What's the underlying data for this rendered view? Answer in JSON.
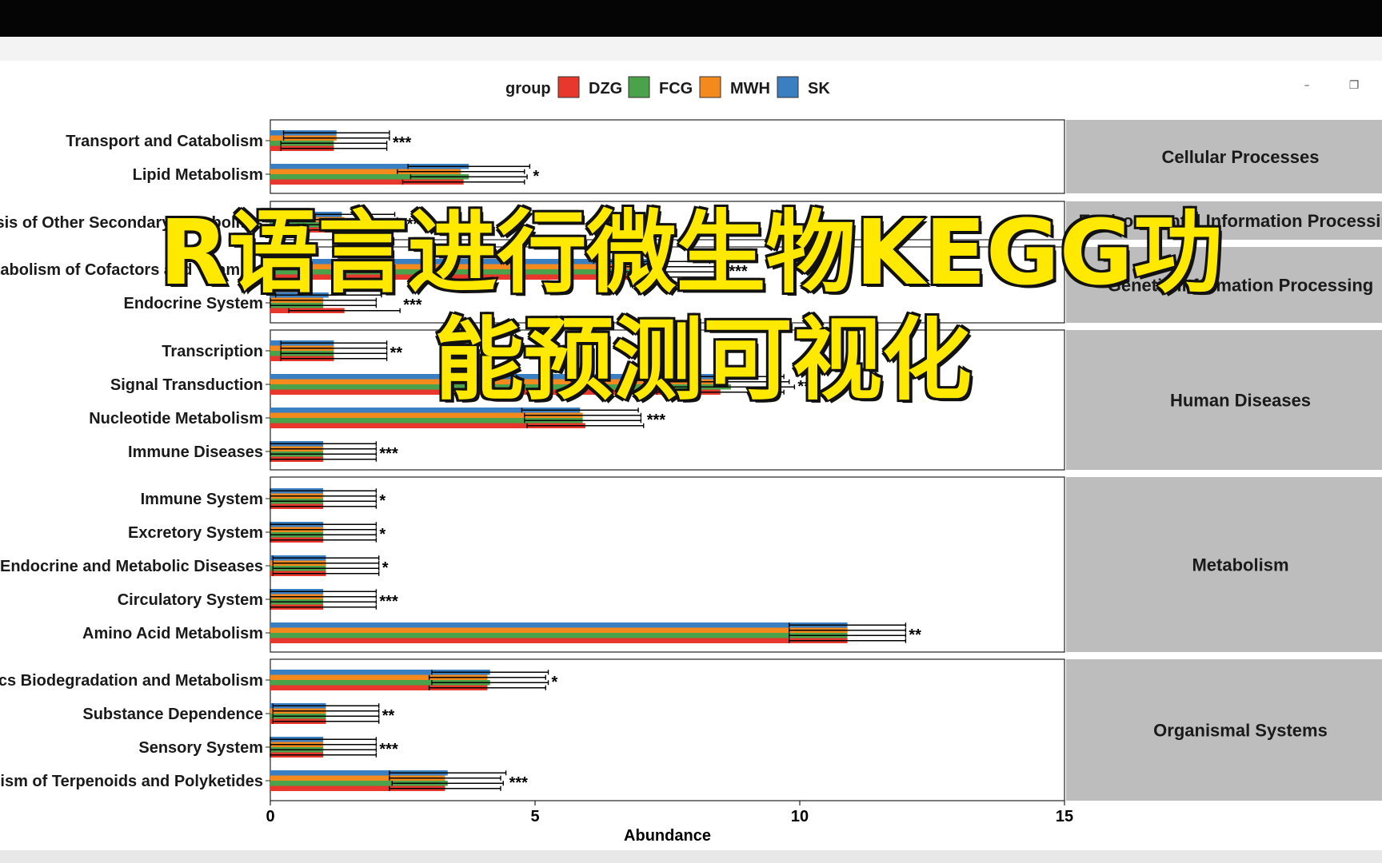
{
  "window": {
    "minimize_icon": "minimize-icon",
    "restore_icon": "restore-icon"
  },
  "overlay": {
    "line1": "R语言进行微生物KEGG功",
    "line2": "能预测可视化"
  },
  "chart_data": {
    "type": "bar",
    "orientation": "horizontal",
    "legend": {
      "title": "group",
      "position": "top",
      "entries": [
        {
          "name": "DZG",
          "color": "#e8372c"
        },
        {
          "name": "FCG",
          "color": "#4aa24a"
        },
        {
          "name": "MWH",
          "color": "#f48a1e"
        },
        {
          "name": "SK",
          "color": "#3a7fc1"
        }
      ]
    },
    "xlabel": "Abundance",
    "xlim": [
      0,
      15
    ],
    "xticks": [
      "0",
      "5",
      "10",
      "15"
    ],
    "grid": false,
    "panels": [
      {
        "label": "Cellular Processes",
        "rows": [
          {
            "label": "Transport and Catabolism",
            "values": [
              1.2,
              1.2,
              1.25,
              1.25
            ],
            "errors": [
              1.0,
              1.0,
              1.0,
              1.0
            ],
            "sig": "***"
          },
          {
            "label": "Lipid Metabolism",
            "values": [
              3.65,
              3.75,
              3.6,
              3.75
            ],
            "errors": [
              1.15,
              1.1,
              1.2,
              1.15
            ],
            "sig": "*"
          }
        ]
      },
      {
        "label": "Environmental Information Processing",
        "rows": [
          {
            "label": "Biosynthesis of Other Secondary Metabolites",
            "values": [
              1.4,
              1.3,
              1.4,
              1.35
            ],
            "errors": [
              1.0,
              1.0,
              1.0,
              1.0
            ],
            "sig": "***"
          }
        ]
      },
      {
        "label": "Genetic Information Processing",
        "rows": [
          {
            "label": "Metabolism of Cofactors and Vitamins",
            "values": [
              7.5,
              7.3,
              7.4,
              7.2
            ],
            "errors": [
              1.1,
              1.1,
              1.1,
              1.1
            ],
            "sig": "***"
          },
          {
            "label": "Endocrine System",
            "values": [
              1.4,
              1.0,
              1.0,
              1.1
            ],
            "errors": [
              1.05,
              1.0,
              1.0,
              1.0
            ],
            "sig": "***"
          }
        ]
      },
      {
        "label": "Human Diseases",
        "rows": [
          {
            "label": "Transcription",
            "values": [
              1.2,
              1.2,
              1.2,
              1.2
            ],
            "errors": [
              1.0,
              1.0,
              1.0,
              1.0
            ],
            "sig": "**"
          },
          {
            "label": "Signal Transduction",
            "values": [
              8.5,
              8.7,
              8.6,
              8.5
            ],
            "errors": [
              1.2,
              1.2,
              1.2,
              1.2
            ],
            "sig": "**"
          },
          {
            "label": "Nucleotide Metabolism",
            "values": [
              5.95,
              5.9,
              5.9,
              5.85
            ],
            "errors": [
              1.1,
              1.1,
              1.1,
              1.1
            ],
            "sig": "***"
          },
          {
            "label": "Immune Diseases",
            "values": [
              1.0,
              1.0,
              1.0,
              1.0
            ],
            "errors": [
              1.0,
              1.0,
              1.0,
              1.0
            ],
            "sig": "***"
          }
        ]
      },
      {
        "label": "Metabolism",
        "rows": [
          {
            "label": "Immune System",
            "values": [
              1.0,
              1.0,
              1.0,
              1.0
            ],
            "errors": [
              1.0,
              1.0,
              1.0,
              1.0
            ],
            "sig": "*"
          },
          {
            "label": "Excretory System",
            "values": [
              1.0,
              1.0,
              1.0,
              1.0
            ],
            "errors": [
              1.0,
              1.0,
              1.0,
              1.0
            ],
            "sig": "*"
          },
          {
            "label": "Endocrine and Metabolic Diseases",
            "values": [
              1.05,
              1.05,
              1.05,
              1.05
            ],
            "errors": [
              1.0,
              1.0,
              1.0,
              1.0
            ],
            "sig": "*"
          },
          {
            "label": "Circulatory System",
            "values": [
              1.0,
              1.0,
              1.0,
              1.0
            ],
            "errors": [
              1.0,
              1.0,
              1.0,
              1.0
            ],
            "sig": "***"
          },
          {
            "label": "Amino Acid Metabolism",
            "values": [
              10.9,
              10.9,
              10.9,
              10.9
            ],
            "errors": [
              1.1,
              1.1,
              1.1,
              1.1
            ],
            "sig": "**"
          }
        ]
      },
      {
        "label": "Organismal Systems",
        "rows": [
          {
            "label": "Xenobiotics Biodegradation and Metabolism",
            "values": [
              4.1,
              4.15,
              4.1,
              4.15
            ],
            "errors": [
              1.1,
              1.1,
              1.1,
              1.1
            ],
            "sig": "*"
          },
          {
            "label": "Substance Dependence",
            "values": [
              1.05,
              1.05,
              1.05,
              1.05
            ],
            "errors": [
              1.0,
              1.0,
              1.0,
              1.0
            ],
            "sig": "**"
          },
          {
            "label": "Sensory System",
            "values": [
              1.0,
              1.0,
              1.0,
              1.0
            ],
            "errors": [
              1.0,
              1.0,
              1.0,
              1.0
            ],
            "sig": "***"
          },
          {
            "label": "Metabolism of Terpenoids and Polyketides",
            "values": [
              3.3,
              3.35,
              3.3,
              3.35
            ],
            "errors": [
              1.05,
              1.05,
              1.05,
              1.1
            ],
            "sig": "***"
          }
        ]
      }
    ]
  }
}
